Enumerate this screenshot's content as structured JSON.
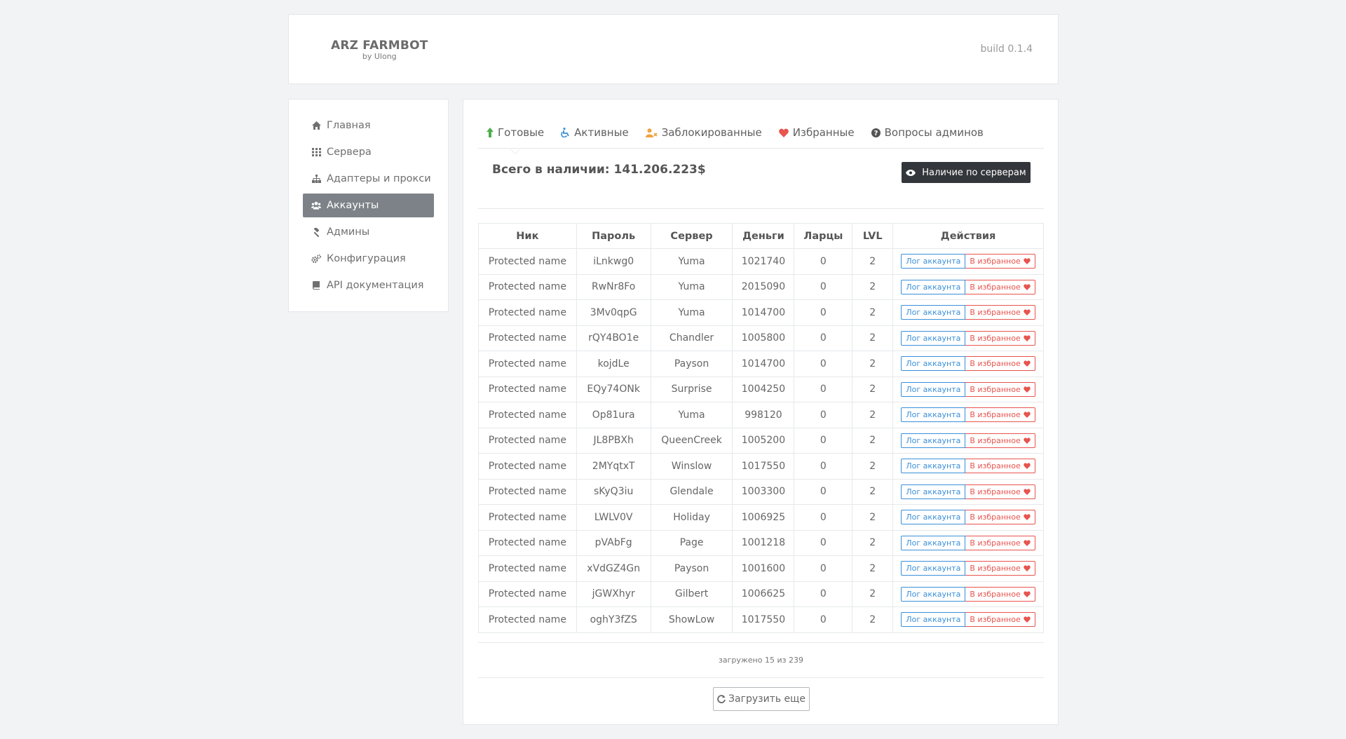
{
  "header": {
    "title": "ARZ FARMBOT",
    "subtitle": "by Ulong",
    "build": "build 0.1.4"
  },
  "sidebar": {
    "items": [
      {
        "label": "Главная",
        "icon": "home-icon"
      },
      {
        "label": "Сервера",
        "icon": "grid-icon"
      },
      {
        "label": "Адаптеры и прокси",
        "icon": "sitemap-icon"
      },
      {
        "label": "Аккаунты",
        "icon": "users-icon",
        "active": true
      },
      {
        "label": "Админы",
        "icon": "gavel-icon"
      },
      {
        "label": "Конфигурация",
        "icon": "gears-icon"
      },
      {
        "label": "API документация",
        "icon": "book-icon"
      }
    ]
  },
  "tabs": [
    {
      "label": "Готовые",
      "icon": "arrow-up-icon",
      "color": "#4cae4c",
      "active": true
    },
    {
      "label": "Активные",
      "icon": "wheelchair-icon",
      "color": "#3a8fd9"
    },
    {
      "label": "Заблокированные",
      "icon": "user-times-icon",
      "color": "#f0a33e"
    },
    {
      "label": "Избранные",
      "icon": "heart-icon",
      "color": "#e8544e"
    },
    {
      "label": "Вопросы админов",
      "icon": "question-circle-icon",
      "color": "#555555"
    }
  ],
  "summary": {
    "total": "Всего в наличии: 141.206.223$",
    "servers_button": "Наличие по серверам"
  },
  "table": {
    "headers": [
      "Ник",
      "Пароль",
      "Сервер",
      "Деньги",
      "Ларцы",
      "LVL",
      "Действия"
    ],
    "rows": [
      [
        "Protected name",
        "iLnkwg0",
        "Yuma",
        "1021740",
        "0",
        "2"
      ],
      [
        "Protected name",
        "RwNr8Fo",
        "Yuma",
        "2015090",
        "0",
        "2"
      ],
      [
        "Protected name",
        "3Mv0qpG",
        "Yuma",
        "1014700",
        "0",
        "2"
      ],
      [
        "Protected name",
        "rQY4BO1e",
        "Chandler",
        "1005800",
        "0",
        "2"
      ],
      [
        "Protected name",
        "kojdLe",
        "Payson",
        "1014700",
        "0",
        "2"
      ],
      [
        "Protected name",
        "EQy74ONk",
        "Surprise",
        "1004250",
        "0",
        "2"
      ],
      [
        "Protected name",
        "Op81ura",
        "Yuma",
        "998120",
        "0",
        "2"
      ],
      [
        "Protected name",
        "JL8PBXh",
        "QueenCreek",
        "1005200",
        "0",
        "2"
      ],
      [
        "Protected name",
        "2MYqtxT",
        "Winslow",
        "1017550",
        "0",
        "2"
      ],
      [
        "Protected name",
        "sKyQ3iu",
        "Glendale",
        "1003300",
        "0",
        "2"
      ],
      [
        "Protected name",
        "LWLV0V",
        "Holiday",
        "1006925",
        "0",
        "2"
      ],
      [
        "Protected name",
        "pVAbFg",
        "Page",
        "1001218",
        "0",
        "2"
      ],
      [
        "Protected name",
        "xVdGZ4Gn",
        "Payson",
        "1001600",
        "0",
        "2"
      ],
      [
        "Protected name",
        "jGWXhyr",
        "Gilbert",
        "1006625",
        "0",
        "2"
      ],
      [
        "Protected name",
        "oghY3fZS",
        "ShowLow",
        "1017550",
        "0",
        "2"
      ]
    ],
    "log_label": "Лог аккаунта",
    "fav_label": "В избранное"
  },
  "footer": {
    "loaded": "загружено 15 из 239",
    "load_more": "Загрузить еще"
  },
  "colors": {
    "log": "#3a8fd9",
    "fav": "#e8544e",
    "active_nav": "#7d8288",
    "dark_button": "#33363a"
  }
}
